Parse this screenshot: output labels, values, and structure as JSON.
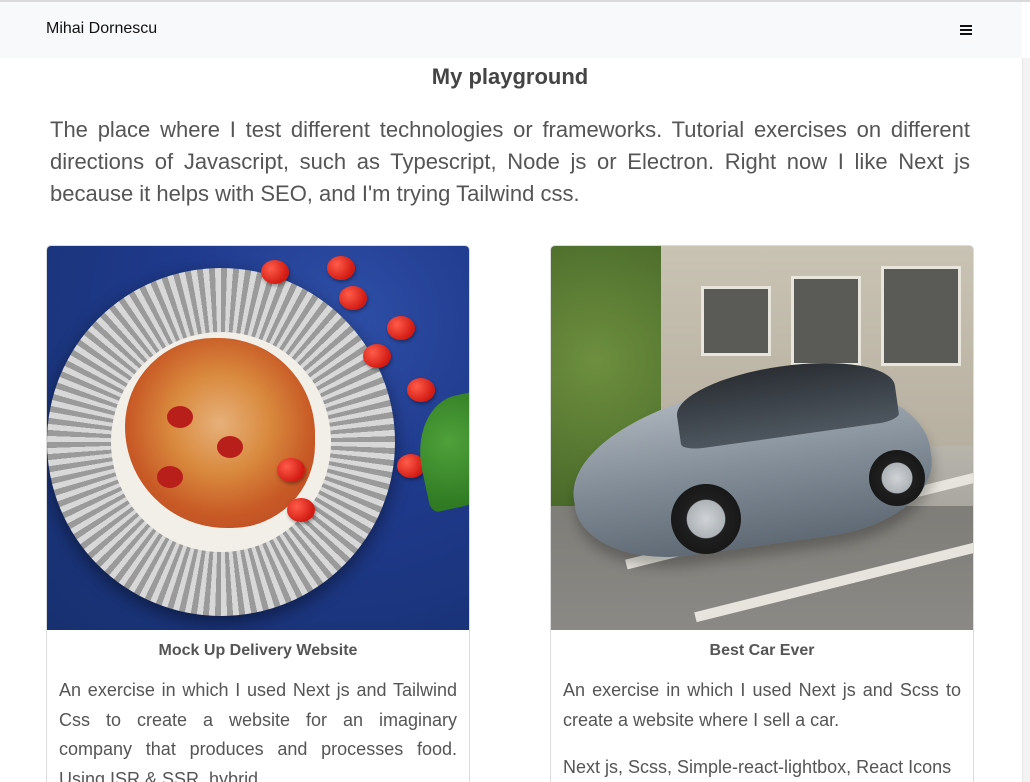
{
  "header": {
    "brand": "Mihai Dornescu",
    "menu_icon": "hamburger-icon"
  },
  "main": {
    "title": "My playground",
    "intro": "The place where I test different technologies or frameworks. Tutorial exercises on different directions of Javascript, such as Typescript, Node js or Electron. Right now I like Next js because it helps with SEO, and I'm trying Tailwind css."
  },
  "cards": [
    {
      "title": "Mock Up Delivery Website",
      "description": "An exercise in which I used Next js and Tailwind Css to create a website for an imaginary company that produces and processes food. Using ISR & SSR, hybrid",
      "tech": ""
    },
    {
      "title": "Best Car Ever",
      "description": "An exercise in which I used Next js and Scss to create a website where I sell a car.",
      "tech": "Next js, Scss, Simple-react-lightbox, React Icons"
    }
  ],
  "colors": {
    "navbar_bg": "#f8f9fa",
    "text": "#555555",
    "border": "#dcdcdc"
  }
}
